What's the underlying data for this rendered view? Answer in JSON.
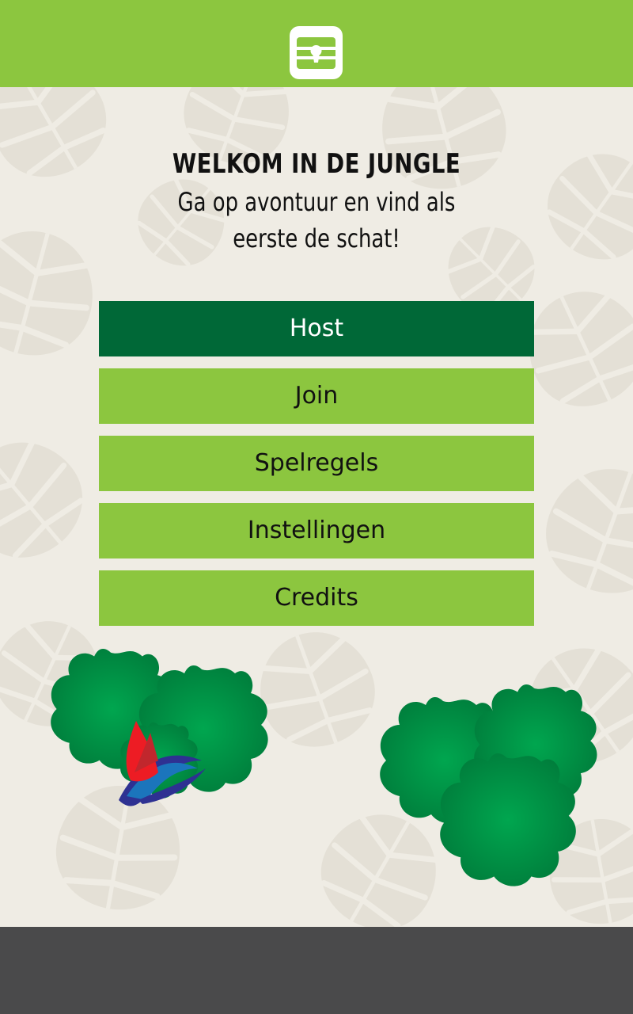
{
  "header": {
    "logo_icon": "keyhole-lock-icon"
  },
  "welcome": {
    "title": "WELKOM IN DE JUNGLE",
    "subtitle": "Ga op avontuur en vind als eerste de schat!"
  },
  "menu": {
    "items": [
      {
        "label": "Host",
        "active": true
      },
      {
        "label": "Join",
        "active": false
      },
      {
        "label": "Spelregels",
        "active": false
      },
      {
        "label": "Instellingen",
        "active": false
      },
      {
        "label": "Credits",
        "active": false
      }
    ]
  },
  "colors": {
    "topbar": "#8cc63f",
    "button": "#8cc63f",
    "button_active": "#006837",
    "background": "#efece4",
    "bottombar": "#4a4a4b",
    "bush": "#00a64f"
  },
  "decorations": {
    "left": "bush-with-parrot-feathers",
    "right": "bush-cluster"
  }
}
